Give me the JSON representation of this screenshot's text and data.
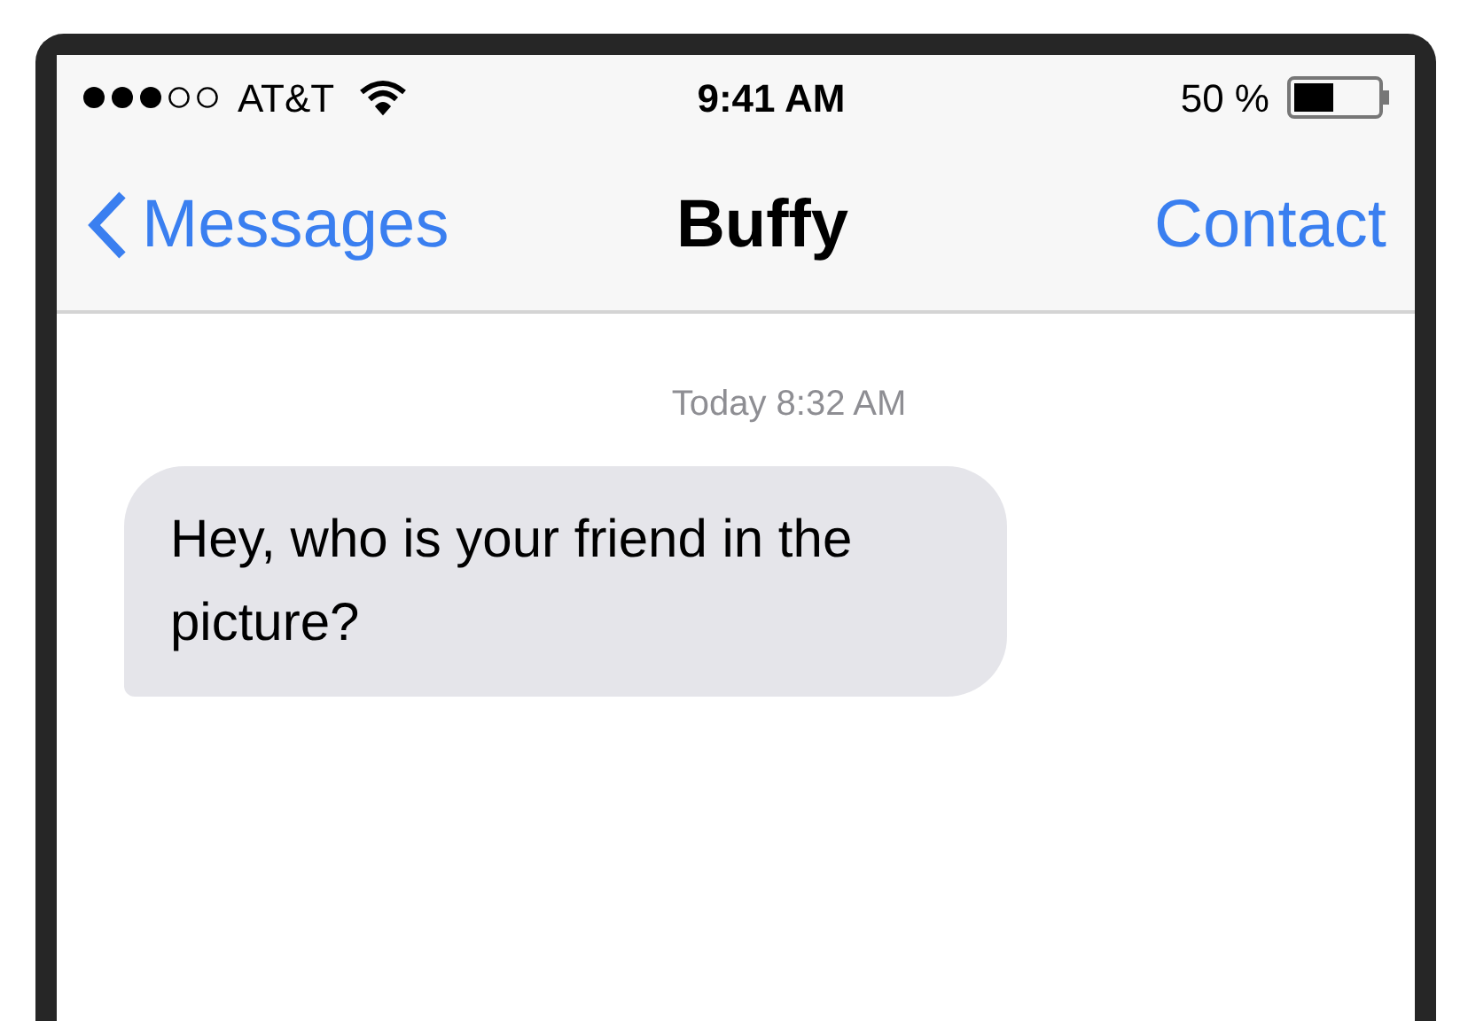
{
  "status_bar": {
    "carrier": "AT&T",
    "time": "9:41 AM",
    "battery": "50 %"
  },
  "nav_bar": {
    "back": "Messages",
    "title": "Buffy",
    "action": "Contact"
  },
  "conversation": {
    "timestamp": "Today 8:32 AM",
    "messages": [
      {
        "kind": "received",
        "text": "Hey, who is your friend in the picture?"
      }
    ]
  }
}
